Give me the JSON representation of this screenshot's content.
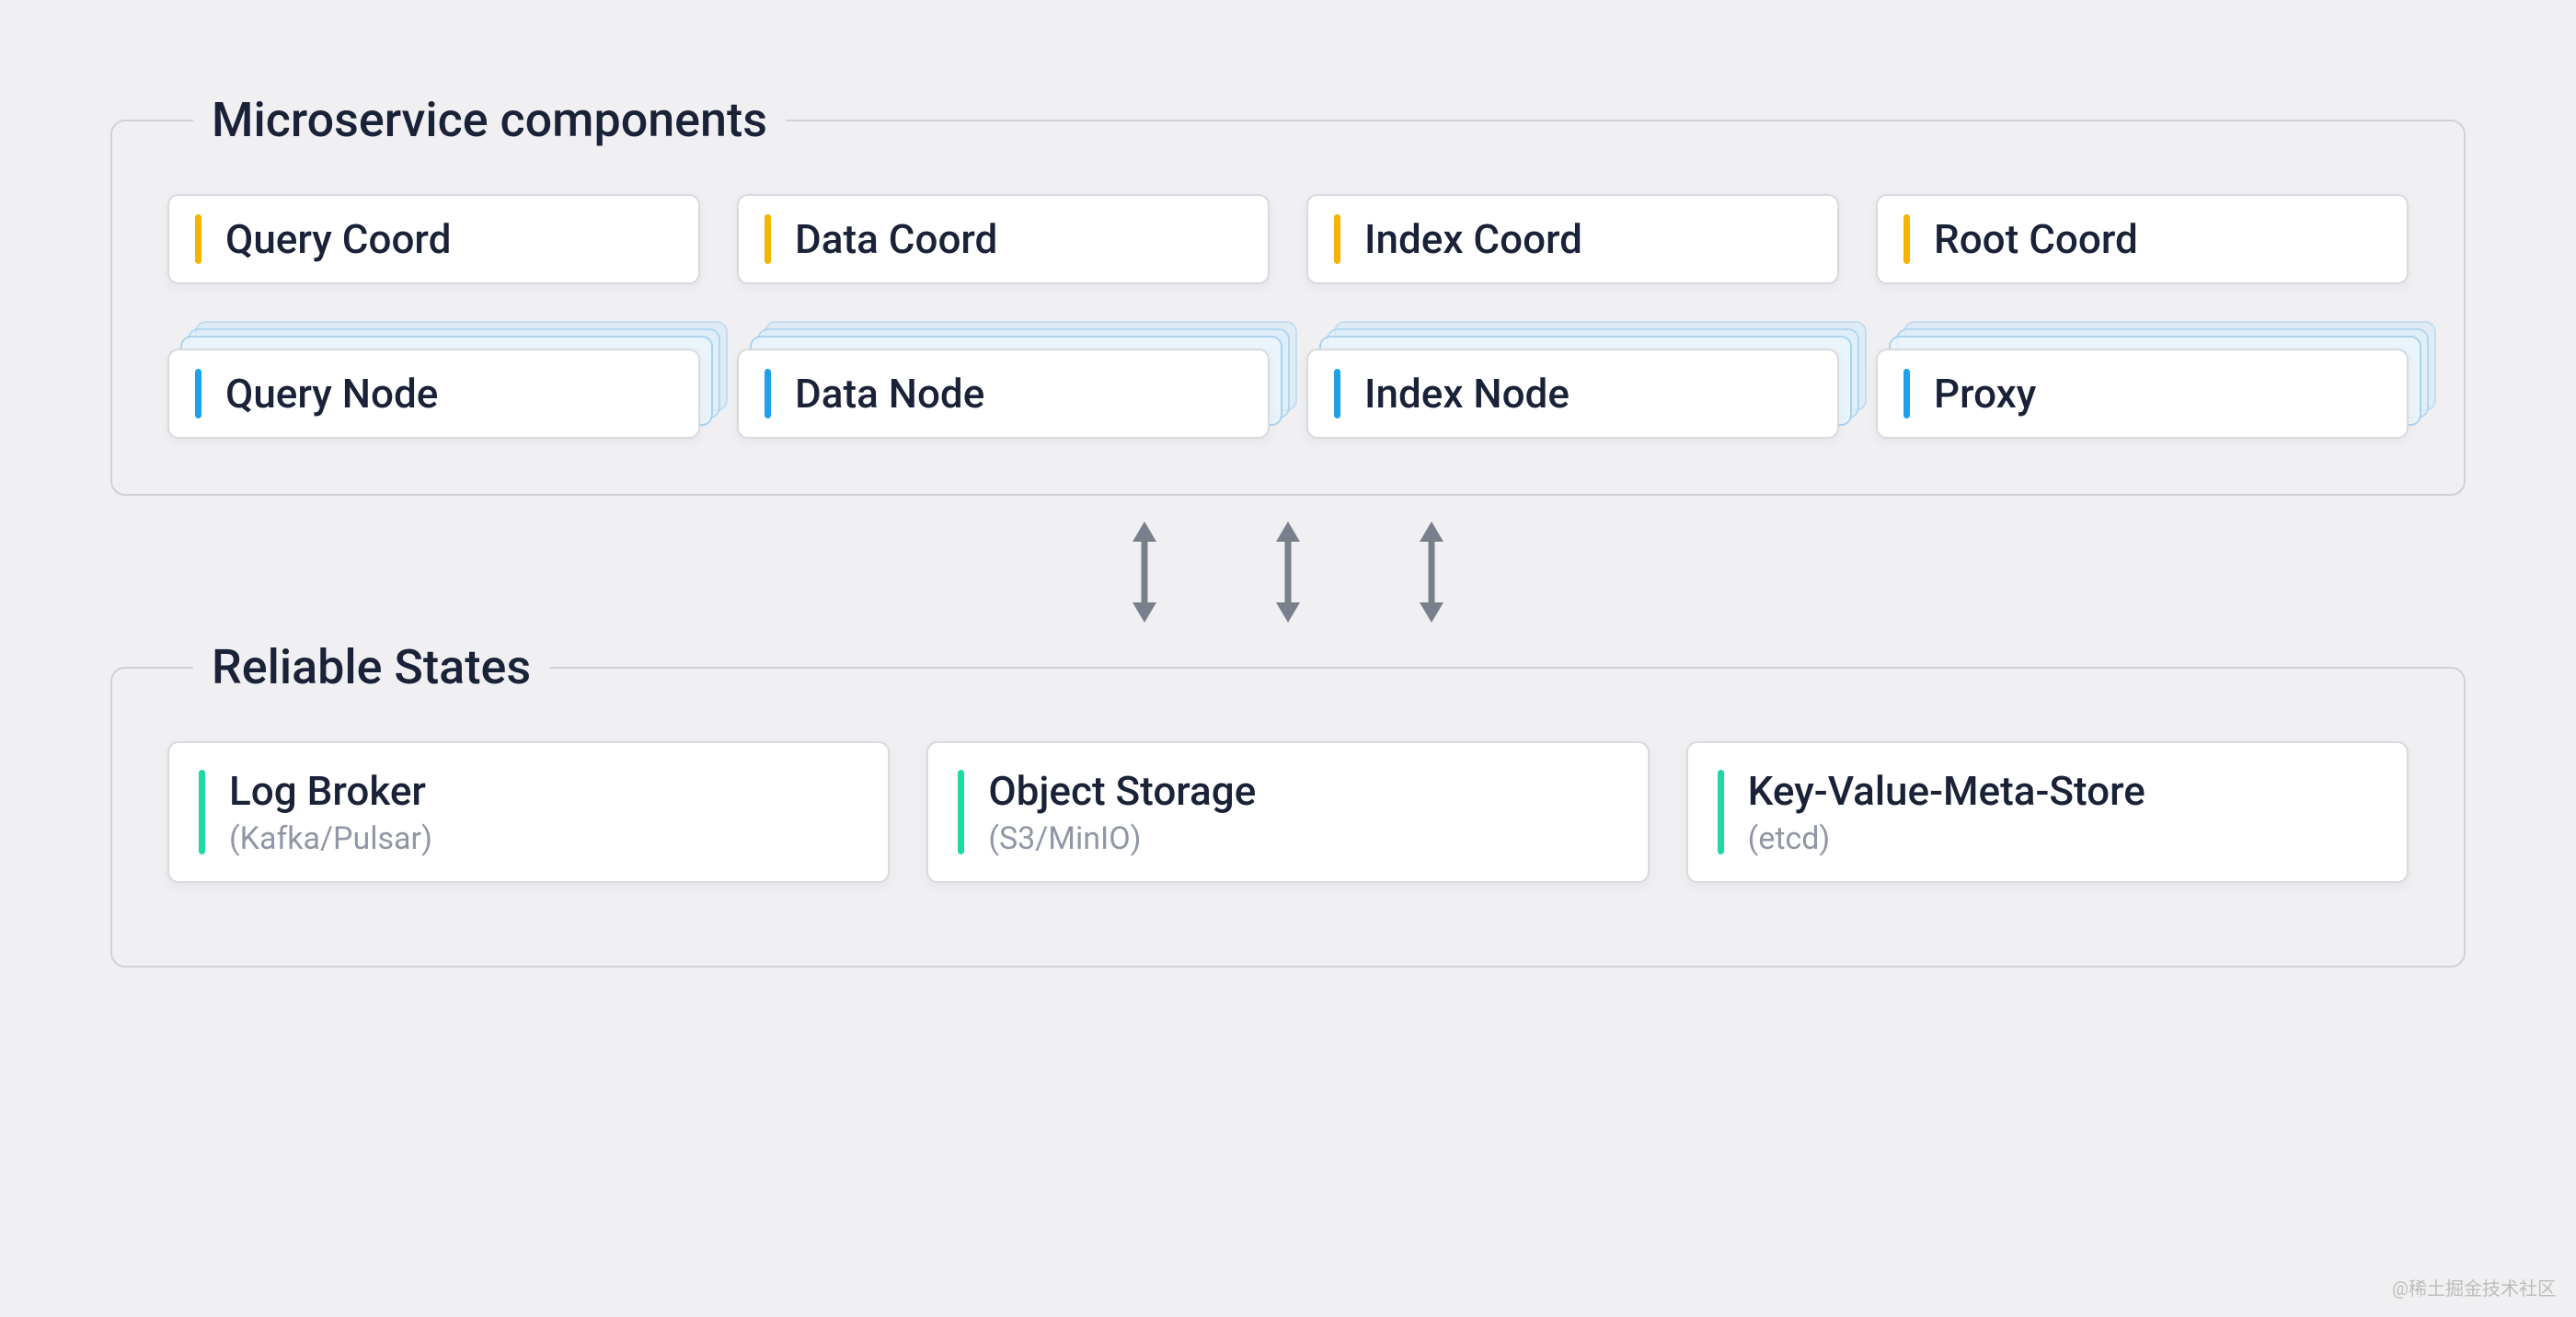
{
  "sections": {
    "microservice": {
      "title": "Microservice components",
      "coords": [
        {
          "label": "Query Coord"
        },
        {
          "label": "Data Coord"
        },
        {
          "label": "Index Coord"
        },
        {
          "label": "Root Coord"
        }
      ],
      "nodes": [
        {
          "label": "Query Node"
        },
        {
          "label": "Data Node"
        },
        {
          "label": "Index Node"
        },
        {
          "label": "Proxy"
        }
      ]
    },
    "reliable": {
      "title": "Reliable States",
      "items": [
        {
          "label": "Log Broker",
          "sublabel": "(Kafka/Pulsar)"
        },
        {
          "label": "Object Storage",
          "sublabel": "(S3/MinIO)"
        },
        {
          "label": "Key-Value-Meta-Store",
          "sublabel": "(etcd)"
        }
      ]
    }
  },
  "accent_colors": {
    "coord": "#f4b400",
    "node": "#1da1e8",
    "state": "#1ed9a3"
  },
  "watermark": "@稀土掘金技术社区"
}
